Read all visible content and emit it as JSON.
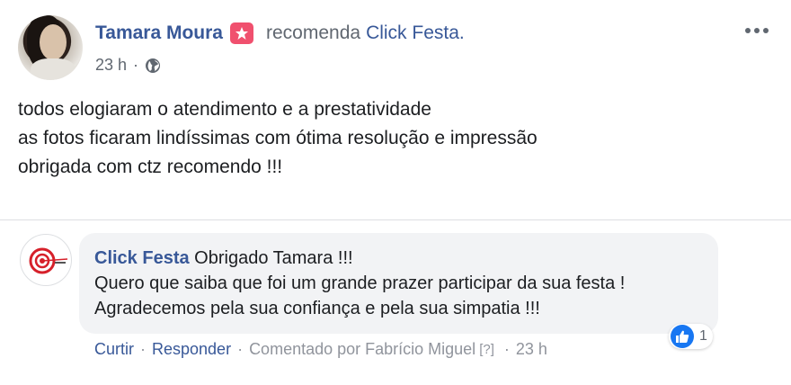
{
  "post": {
    "author": "Tamara Moura",
    "recommend_text": "recomenda",
    "page_name": "Click Festa.",
    "time": "23 h",
    "time_separator": "·",
    "body_lines": [
      "todos elogiaram o atendimento e a prestatividade",
      "as fotos ficaram lindíssimas com ótima resolução e impressão",
      "obrigada com ctz recomendo !!!"
    ]
  },
  "comment": {
    "author": "Click Festa",
    "first_line_rest": "Obrigado Tamara !!!",
    "lines": [
      "Quero que saiba que foi um grande prazer participar da sua festa !",
      "Agradecemos pela sua confiança e pela sua simpatia !!!"
    ],
    "like_label": "Curtir",
    "reply_label": "Responder",
    "commented_by": "Comentado por Fabrício Miguel",
    "help": "[?]",
    "time": "23 h",
    "sep": "·",
    "reaction_count": "1"
  },
  "colors": {
    "link": "#385898",
    "meta": "#606770",
    "recommend_badge": "#f0506e",
    "like_blue": "#1877f2",
    "bubble": "#f2f3f5",
    "brand_red": "#d6202a"
  },
  "icons": {
    "recommend": "star-badge-icon",
    "privacy": "globe-icon",
    "more": "more-options-icon",
    "like": "thumbs-up-icon"
  }
}
